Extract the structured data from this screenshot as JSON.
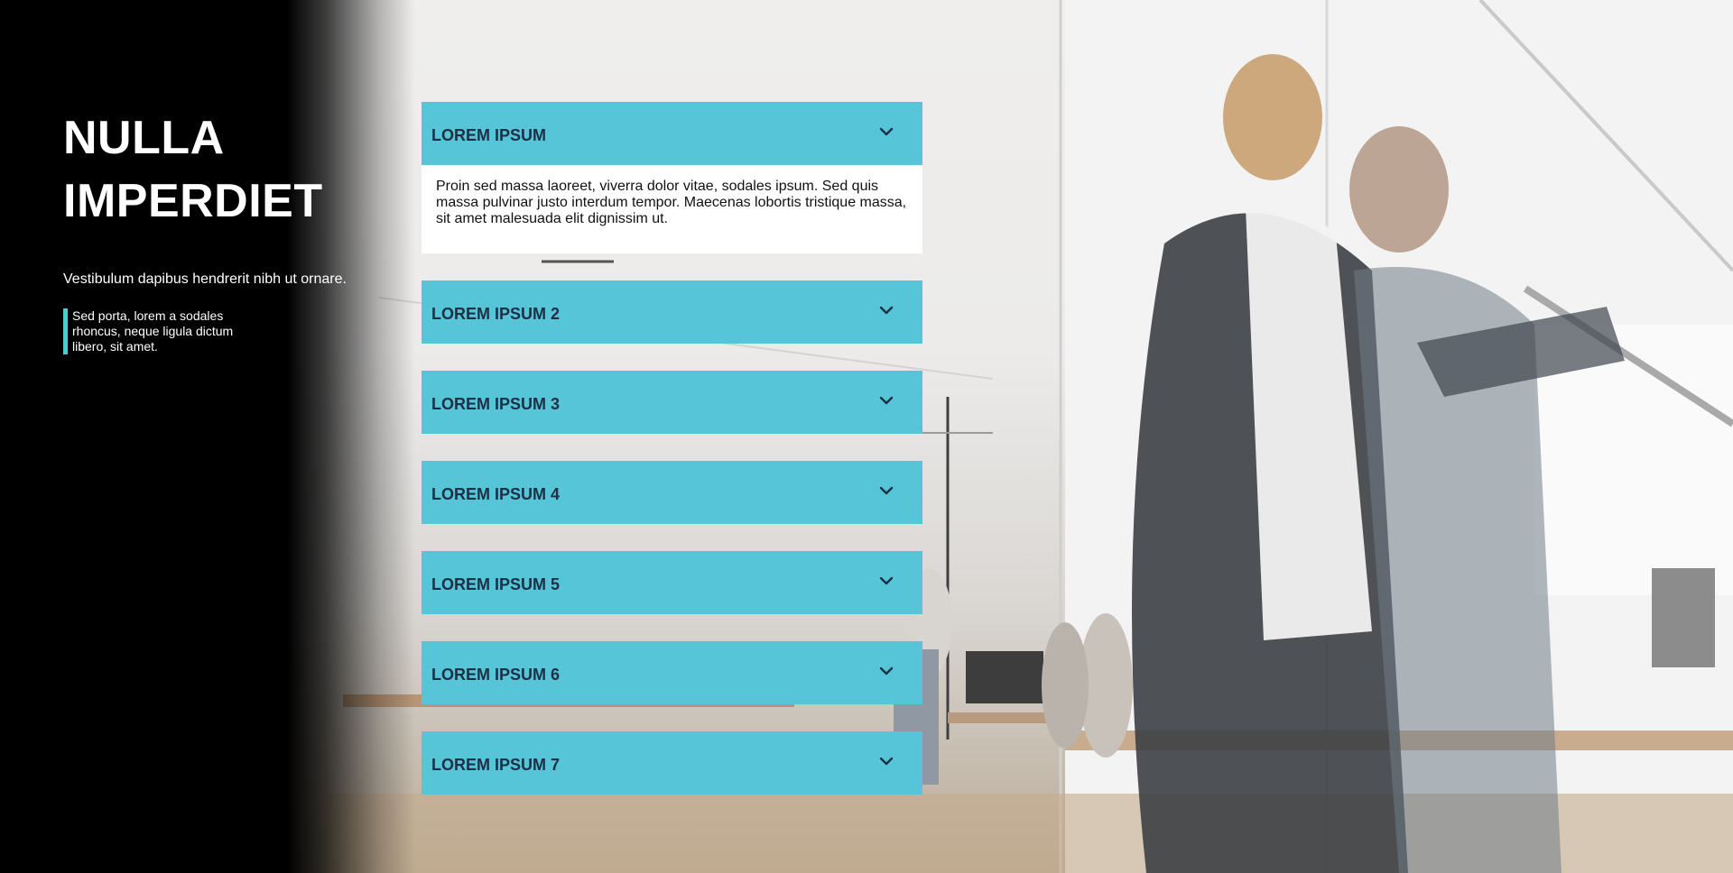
{
  "hero": {
    "title": "NULLA IMPERDIET",
    "subtitle": "Vestibulum dapibus hendrerit nibh ut ornare.",
    "quote": "Sed porta, lorem a sodales rhoncus, neque ligula dictum libero, sit amet."
  },
  "accordion": {
    "items": [
      {
        "label": "LOREM IPSUM",
        "expanded": true,
        "body": "Proin sed massa laoreet, viverra dolor vitae, sodales ipsum. Sed quis massa pulvinar justo interdum tempor. Maecenas lobortis tristique massa, sit amet malesuada elit dignissim ut."
      },
      {
        "label": "LOREM IPSUM 2",
        "expanded": false
      },
      {
        "label": "LOREM IPSUM 3",
        "expanded": false
      },
      {
        "label": "LOREM IPSUM 4",
        "expanded": false
      },
      {
        "label": "LOREM IPSUM 5",
        "expanded": false
      },
      {
        "label": "LOREM IPSUM 6",
        "expanded": false
      },
      {
        "label": "LOREM IPSUM 7",
        "expanded": false
      }
    ],
    "chevron_icon": "chevron-down-icon"
  },
  "colors": {
    "accent": "#56c5d8",
    "header_text": "#1c2f44",
    "left_panel": "#000000"
  }
}
